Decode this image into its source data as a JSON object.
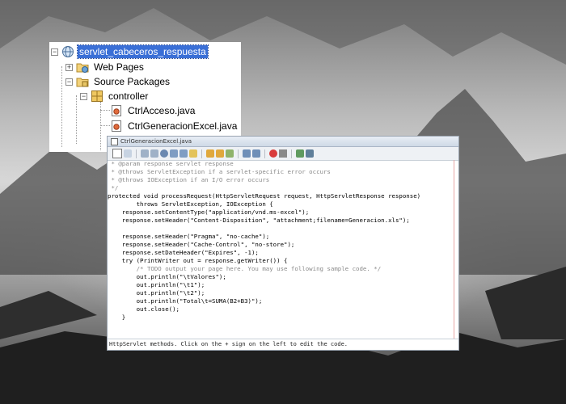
{
  "tree": {
    "project": "servlet_cabeceros_respuesta",
    "web_pages": "Web Pages",
    "source_packages": "Source Packages",
    "package": "controller",
    "files": [
      "CtrlAcceso.java",
      "CtrlGeneracionExcel.java"
    ],
    "toggle_expanded": "−",
    "toggle_collapsed": "+"
  },
  "editor": {
    "tab_label": "CtrlGeneracionExcel.java",
    "code_lines": [
      {
        "text": " * @param response servlet response",
        "style": "cm"
      },
      {
        "text": " * @throws ServletException if a servlet-specific error occurs",
        "style": "cm"
      },
      {
        "text": " * @throws IOException if an I/O error occurs",
        "style": "cm"
      },
      {
        "text": " */",
        "style": "cm"
      },
      {
        "text": "protected void processRequest(HttpServletRequest request, HttpServletResponse response)",
        "style": "plain"
      },
      {
        "text": "        throws ServletException, IOException {",
        "style": "plain"
      },
      {
        "text": "    response.setContentType(\"application/vnd.ms-excel\");",
        "style": "plain"
      },
      {
        "text": "    response.setHeader(\"Content-Disposition\", \"attachment;filename=Generacion.xls\");",
        "style": "plain"
      },
      {
        "text": "",
        "style": "plain"
      },
      {
        "text": "    response.setHeader(\"Pragma\", \"no-cache\");",
        "style": "plain"
      },
      {
        "text": "    response.setHeader(\"Cache-Control\", \"no-store\");",
        "style": "plain"
      },
      {
        "text": "    response.setDateHeader(\"Expires\", -1);",
        "style": "plain"
      },
      {
        "text": "    try (PrintWriter out = response.getWriter()) {",
        "style": "plain"
      },
      {
        "text": "        /* TODO output your page here. You may use following sample code. */",
        "style": "cm"
      },
      {
        "text": "        out.println(\"\\tValores\");",
        "style": "plain"
      },
      {
        "text": "        out.println(\"\\t1\");",
        "style": "plain"
      },
      {
        "text": "        out.println(\"\\t2\");",
        "style": "plain"
      },
      {
        "text": "        out.println(\"Total\\t=SUMA(B2+B3)\");",
        "style": "plain"
      },
      {
        "text": "        out.close();",
        "style": "plain"
      },
      {
        "text": "    }",
        "style": "plain"
      }
    ],
    "status_text": "HttpServlet methods. Click on the + sign on the left to edit the code."
  }
}
